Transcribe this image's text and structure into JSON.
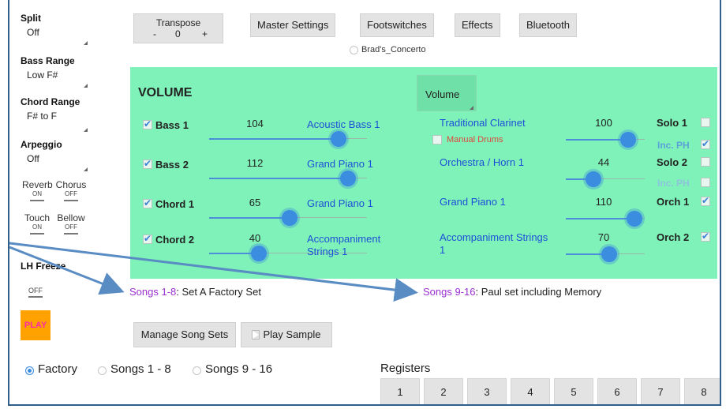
{
  "sidebar": {
    "split": {
      "title": "Split",
      "value": "Off"
    },
    "bass_range": {
      "title": "Bass Range",
      "value": "Low F#"
    },
    "chord_range": {
      "title": "Chord Range",
      "value": "F# to F"
    },
    "arpeggio": {
      "title": "Arpeggio",
      "value": "Off"
    },
    "reverb": {
      "label": "Reverb",
      "state": "ON"
    },
    "chorus": {
      "label": "Chorus",
      "state": "OFF"
    },
    "touch": {
      "label": "Touch",
      "state": "ON"
    },
    "bellow": {
      "label": "Bellow",
      "state": "OFF"
    },
    "lh_freeze": {
      "label": "LH Freeze",
      "state": "OFF"
    },
    "play_label": "PLAY"
  },
  "toolbar": {
    "transpose_label": "Transpose",
    "transpose_minus": "-",
    "transpose_value": "0",
    "transpose_plus": "+",
    "master_settings": "Master Settings",
    "footswitches": "Footswitches",
    "effects": "Effects",
    "bluetooth": "Bluetooth",
    "preset_name": "Brad's_Concerto"
  },
  "volume_panel": {
    "title": "VOLUME",
    "dropdown_label": "Volume",
    "left_rows": [
      {
        "label": "Bass 1",
        "checked": true,
        "value": 104,
        "instrument": "Acoustic Bass 1"
      },
      {
        "label": "Bass 2",
        "checked": true,
        "value": 112,
        "instrument": "Grand Piano 1"
      },
      {
        "label": "Chord 1",
        "checked": true,
        "value": 65,
        "instrument": "Grand Piano 1"
      },
      {
        "label": "Chord 2",
        "checked": true,
        "value": 40,
        "instrument": "Accompaniment Strings 1"
      }
    ],
    "right_rows": [
      {
        "instrument": "Traditional Clarinet",
        "value": 100,
        "label": "Solo 1",
        "checked": false
      },
      {
        "instrument": "Orchestra / Horn 1",
        "value": 44,
        "label": "Solo 2",
        "checked": false
      },
      {
        "instrument": "Grand Piano 1",
        "value": 110,
        "label": "Orch 1",
        "checked": true
      },
      {
        "instrument": "Accompaniment Strings 1",
        "value": 70,
        "label": "Orch 2",
        "checked": true
      }
    ],
    "manual_drums": "Manual Drums",
    "inc_ph_label": "Inc. PH",
    "inc_ph_1_checked": true,
    "inc_ph_2_checked": false
  },
  "song_sets": {
    "set1_range": "Songs 1-8",
    "set1_name": ": Set A Factory Set",
    "set2_range": "Songs 9-16",
    "set2_name": ": Paul set including Memory"
  },
  "actions": {
    "manage_song_sets": "Manage Song Sets",
    "play_sample": "Play Sample"
  },
  "source": {
    "options": [
      "Factory",
      "Songs 1 - 8",
      "Songs 9 - 16"
    ],
    "selected": "Factory"
  },
  "registers": {
    "title": "Registers",
    "buttons": [
      "1",
      "2",
      "3",
      "4",
      "5",
      "6",
      "7",
      "8"
    ]
  },
  "colors": {
    "panel_bg": "#7ef2b8",
    "accent": "#3b8de0",
    "instrument_link": "#1e4fd8",
    "song_range": "#9b2fd0",
    "play_bg": "#ffa200",
    "play_text": "#ff2aa8",
    "arrow": "#5a8cc4"
  }
}
